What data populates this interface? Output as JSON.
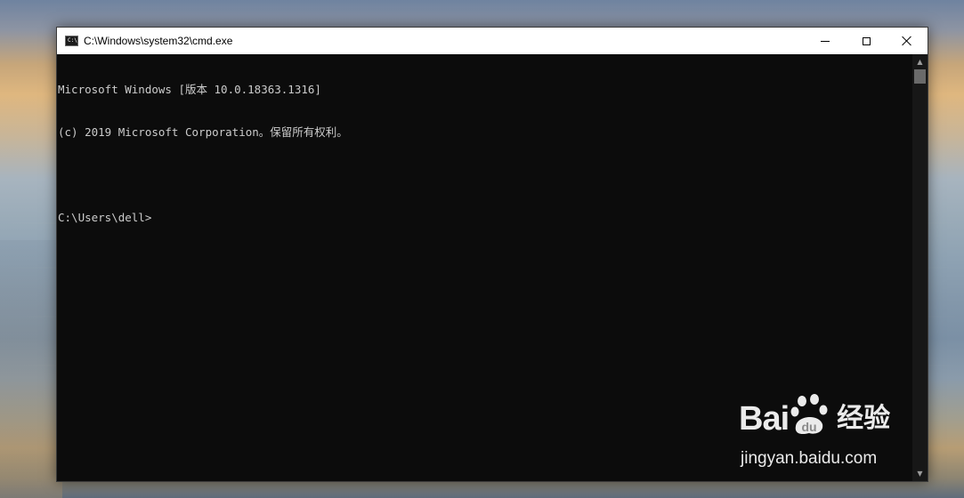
{
  "window": {
    "title": "C:\\Windows\\system32\\cmd.exe",
    "app_icon_glyph": "C:\\"
  },
  "console": {
    "lines": [
      "Microsoft Windows [版本 10.0.18363.1316]",
      "(c) 2019 Microsoft Corporation。保留所有权利。",
      "",
      "C:\\Users\\dell>"
    ]
  },
  "icons": {
    "app": "cmd-icon",
    "minimize": "minimize-icon",
    "maximize": "maximize-icon",
    "close": "close-icon",
    "scroll_up": "scroll-up-arrow-icon",
    "scroll_down": "scroll-down-arrow-icon",
    "scroll_up_glyph": "▲",
    "scroll_down_glyph": "▼"
  },
  "colors": {
    "console_bg": "#0c0c0c",
    "console_text": "#cccccc",
    "titlebar_bg": "#ffffff"
  },
  "watermark": {
    "brand": "Bai",
    "brand_suffix": "经验",
    "url": "jingyan.baidu.com"
  }
}
